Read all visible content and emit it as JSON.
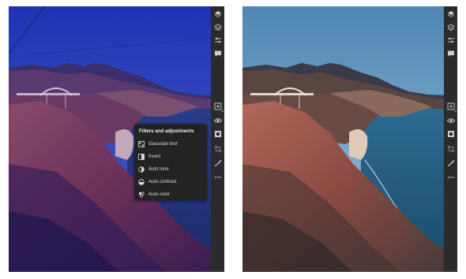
{
  "filters_menu": {
    "title": "Filters and adjustments",
    "items": [
      {
        "label": "Gaussian blur",
        "icon": "blur-icon"
      },
      {
        "label": "Invert",
        "icon": "invert-icon"
      },
      {
        "label": "Auto tone",
        "icon": "auto-tone-icon"
      },
      {
        "label": "Auto contrast",
        "icon": "auto-contrast-icon"
      },
      {
        "label": "Auto color",
        "icon": "auto-color-icon"
      }
    ]
  },
  "toolbar_icons_top": [
    "layers-icon",
    "layer-properties-icon",
    "adjustments-icon",
    "comments-icon"
  ],
  "toolbar_icons_bottom": [
    "add-layer-icon",
    "visibility-eye-icon",
    "mask-icon",
    "crop-icon",
    "brush-icon",
    "more-options-icon"
  ],
  "colors": {
    "toolbar": "#2b2b2b",
    "menu_bg": "#232323",
    "before_sky": "#2b3fb6",
    "after_sky": "#6a9ac0"
  }
}
